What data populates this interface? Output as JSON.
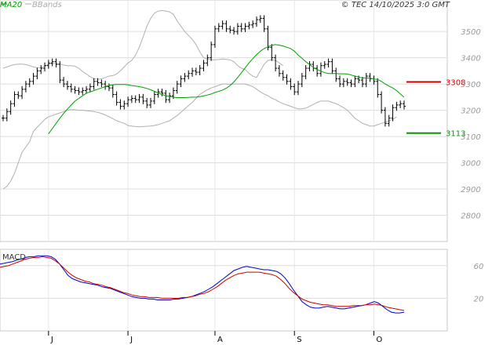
{
  "header": {
    "ma_label": "MA20",
    "bb_label": "BBands",
    "source": "© TEC 14/10/2025 3:0 GMT"
  },
  "chart_data": [
    {
      "type": "ohlc",
      "ylim": [
        2700,
        3620
      ],
      "y_ticks": [
        2800,
        2900,
        3000,
        3100,
        3200,
        3300,
        3400,
        3500
      ],
      "y_tick_labels": [
        "2800",
        "2900",
        "3000",
        "3100",
        "3200",
        "3300",
        "3400",
        "3500"
      ],
      "x_ticks": [
        "J",
        "J",
        "A",
        "S",
        "O"
      ],
      "x_tick_index": [
        12,
        33,
        56,
        77,
        98
      ],
      "grid": true,
      "close": [
        3170,
        3195,
        3225,
        3260,
        3255,
        3280,
        3300,
        3310,
        3330,
        3350,
        3360,
        3370,
        3380,
        3385,
        3375,
        3315,
        3300,
        3290,
        3280,
        3275,
        3270,
        3275,
        3280,
        3290,
        3310,
        3305,
        3300,
        3290,
        3285,
        3260,
        3230,
        3215,
        3225,
        3240,
        3245,
        3240,
        3250,
        3235,
        3220,
        3235,
        3260,
        3270,
        3265,
        3240,
        3255,
        3275,
        3300,
        3320,
        3330,
        3340,
        3350,
        3345,
        3360,
        3380,
        3400,
        3450,
        3510,
        3520,
        3530,
        3510,
        3505,
        3500,
        3520,
        3510,
        3520,
        3525,
        3530,
        3545,
        3550,
        3510,
        3440,
        3400,
        3360,
        3340,
        3325,
        3310,
        3290,
        3270,
        3300,
        3330,
        3360,
        3375,
        3360,
        3340,
        3370,
        3375,
        3385,
        3350,
        3320,
        3300,
        3310,
        3305,
        3300,
        3320,
        3315,
        3300,
        3330,
        3320,
        3310,
        3260,
        3200,
        3150,
        3170,
        3210,
        3220,
        3225,
        3215
      ],
      "ma20": [
        3110,
        3130,
        3150,
        3170,
        3188,
        3205,
        3220,
        3235,
        3245,
        3255,
        3265,
        3270,
        3275,
        3280,
        3285,
        3290,
        3295,
        3297,
        3298,
        3298,
        3298,
        3297,
        3294,
        3292,
        3290,
        3287,
        3283,
        3278,
        3272,
        3266,
        3260,
        3255,
        3253,
        3250,
        3248,
        3248,
        3248,
        3249,
        3250,
        3250,
        3252,
        3255,
        3258,
        3262,
        3268,
        3272,
        3277,
        3284,
        3294,
        3308,
        3325,
        3343,
        3362,
        3380,
        3397,
        3412,
        3425,
        3435,
        3442,
        3448,
        3450,
        3448,
        3445,
        3440,
        3435,
        3425,
        3410,
        3398,
        3385,
        3374,
        3363,
        3355,
        3349,
        3343,
        3340,
        3340,
        3340,
        3339,
        3339,
        3338,
        3334,
        3330,
        3326,
        3323,
        3323,
        3322,
        3319,
        3317,
        3310,
        3300,
        3292,
        3285,
        3275,
        3262,
        3250
      ],
      "bb_upper": [
        3360,
        3365,
        3370,
        3374,
        3376,
        3376,
        3374,
        3370,
        3365,
        3362,
        3362,
        3368,
        3375,
        3378,
        3378,
        3376,
        3372,
        3370,
        3370,
        3368,
        3360,
        3348,
        3338,
        3328,
        3320,
        3318,
        3320,
        3325,
        3330,
        3332,
        3338,
        3350,
        3365,
        3380,
        3390,
        3410,
        3440,
        3480,
        3520,
        3550,
        3570,
        3578,
        3580,
        3578,
        3575,
        3565,
        3540,
        3520,
        3500,
        3485,
        3470,
        3450,
        3422,
        3400,
        3395,
        3392,
        3392,
        3393,
        3395,
        3394,
        3392,
        3385,
        3370,
        3360,
        3355,
        3340,
        3330,
        3325,
        3350,
        3375,
        3390,
        3392,
        3390,
        3380,
        3370
      ],
      "bb_lower": [
        2900,
        2910,
        2930,
        2960,
        3000,
        3040,
        3060,
        3080,
        3120,
        3135,
        3150,
        3165,
        3175,
        3180,
        3185,
        3190,
        3195,
        3200,
        3202,
        3202,
        3200,
        3200,
        3198,
        3197,
        3195,
        3192,
        3188,
        3182,
        3175,
        3168,
        3160,
        3155,
        3150,
        3142,
        3140,
        3138,
        3137,
        3138,
        3139,
        3140,
        3142,
        3145,
        3150,
        3155,
        3160,
        3170,
        3180,
        3192,
        3205,
        3218,
        3230,
        3245,
        3260,
        3270,
        3278,
        3285,
        3290,
        3295,
        3300,
        3300,
        3298,
        3300,
        3300,
        3300,
        3300,
        3295,
        3290,
        3280,
        3270,
        3262,
        3255,
        3246,
        3240,
        3232,
        3225,
        3220,
        3215,
        3210,
        3205,
        3205,
        3208,
        3215,
        3222,
        3230,
        3235,
        3235,
        3235,
        3230,
        3225,
        3218,
        3210,
        3200,
        3185,
        3170,
        3160,
        3150,
        3145,
        3140,
        3140,
        3145,
        3150,
        3155,
        3160,
        3165,
        3175
      ],
      "bb_offset": 0,
      "annotations": [
        {
          "label": "3308",
          "value": 3308,
          "color": "#cc0000"
        },
        {
          "label": "3113",
          "value": 3113,
          "color": "#009900"
        }
      ]
    },
    {
      "type": "line",
      "title": "MACD",
      "ylim": [
        -20,
        80
      ],
      "y_ticks": [
        60,
        20
      ],
      "y_tick_labels": [
        "60",
        "20"
      ],
      "series": [
        {
          "color": "#0000cc",
          "values": [
            62,
            63,
            64,
            65,
            67,
            68,
            70,
            71,
            71,
            72,
            72,
            72,
            71,
            68,
            62,
            55,
            48,
            44,
            42,
            40,
            39,
            38,
            37,
            36,
            34,
            33,
            32,
            30,
            28,
            26,
            24,
            22,
            21,
            20,
            20,
            19,
            19,
            18,
            18,
            18,
            18,
            19,
            19,
            20,
            21,
            22,
            24,
            26,
            28,
            31,
            34,
            38,
            42,
            46,
            50,
            54,
            56,
            58,
            59,
            58,
            57,
            56,
            55,
            55,
            54,
            53,
            50,
            45,
            38,
            30,
            23,
            16,
            12,
            9,
            8,
            8,
            9,
            10,
            9,
            8,
            7,
            7,
            8,
            9,
            10,
            11,
            12,
            14,
            16,
            14,
            10,
            6,
            3,
            2,
            2,
            3
          ]
        },
        {
          "color": "#cc0000",
          "values": [
            58,
            59,
            60,
            62,
            64,
            66,
            68,
            69,
            70,
            70,
            71,
            70,
            69,
            66,
            62,
            57,
            52,
            48,
            45,
            43,
            41,
            40,
            38,
            37,
            36,
            34,
            33,
            31,
            29,
            27,
            26,
            24,
            23,
            22,
            22,
            21,
            21,
            21,
            20,
            20,
            20,
            20,
            20,
            21,
            21,
            22,
            23,
            25,
            26,
            28,
            31,
            34,
            38,
            42,
            45,
            48,
            50,
            51,
            52,
            52,
            52,
            52,
            51,
            50,
            49,
            47,
            43,
            38,
            32,
            27,
            23,
            19,
            17,
            15,
            14,
            13,
            12,
            12,
            11,
            10,
            10,
            10,
            10,
            11,
            11,
            11,
            12,
            12,
            13,
            12,
            11,
            9,
            8,
            7,
            6,
            5
          ]
        }
      ]
    }
  ]
}
